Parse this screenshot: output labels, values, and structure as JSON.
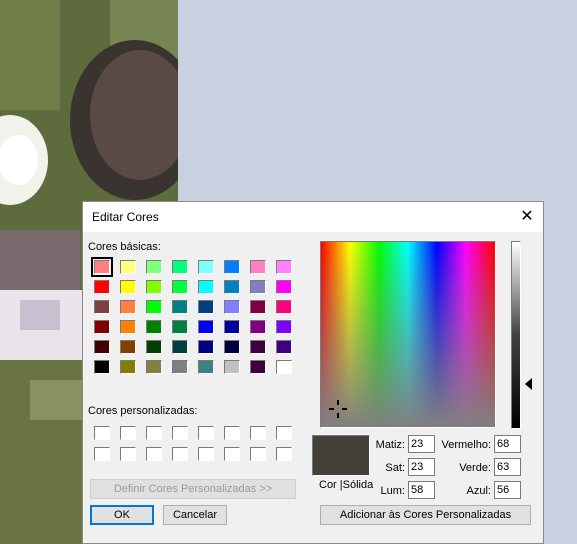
{
  "dialog": {
    "title": "Editar Cores",
    "close_label": "✕",
    "basic_colors_label": "Cores básicas:",
    "custom_colors_label": "Cores personalizadas:",
    "define_custom_button": "Definir Cores Personalizadas >>",
    "ok_button": "OK",
    "cancel_button": "Cancelar",
    "add_custom_button": "Adicionar às Cores Personalizadas",
    "color_solid_label": "Cor |Sólida",
    "hue_label": "Matiz:",
    "sat_label": "Sat:",
    "lum_label": "Lum:",
    "red_label": "Vermelho:",
    "green_label": "Verde:",
    "blue_label": "Azul:",
    "hue_value": "23",
    "sat_value": "23",
    "lum_value": "58",
    "red_value": "68",
    "green_value": "63",
    "blue_value": "56"
  },
  "current_color": "#443F38",
  "basic_colors": [
    [
      "#ff8080",
      "#ffff80",
      "#80ff80",
      "#00ff80",
      "#80ffff",
      "#0080ff",
      "#ff80c0",
      "#ff80ff"
    ],
    [
      "#ff0000",
      "#ffff00",
      "#80ff00",
      "#00ff40",
      "#00ffff",
      "#0080c0",
      "#8080c0",
      "#ff00ff"
    ],
    [
      "#804040",
      "#ff8040",
      "#00ff00",
      "#008080",
      "#004080",
      "#8080ff",
      "#800040",
      "#ff0080"
    ],
    [
      "#800000",
      "#ff8000",
      "#008000",
      "#008040",
      "#0000ff",
      "#0000a0",
      "#800080",
      "#8000ff"
    ],
    [
      "#400000",
      "#804000",
      "#004000",
      "#004040",
      "#000080",
      "#000040",
      "#400040",
      "#400080"
    ],
    [
      "#000000",
      "#808000",
      "#808040",
      "#808080",
      "#408080",
      "#c0c0c0",
      "#400040",
      "#ffffff"
    ]
  ],
  "selected_basic": [
    0,
    0
  ]
}
